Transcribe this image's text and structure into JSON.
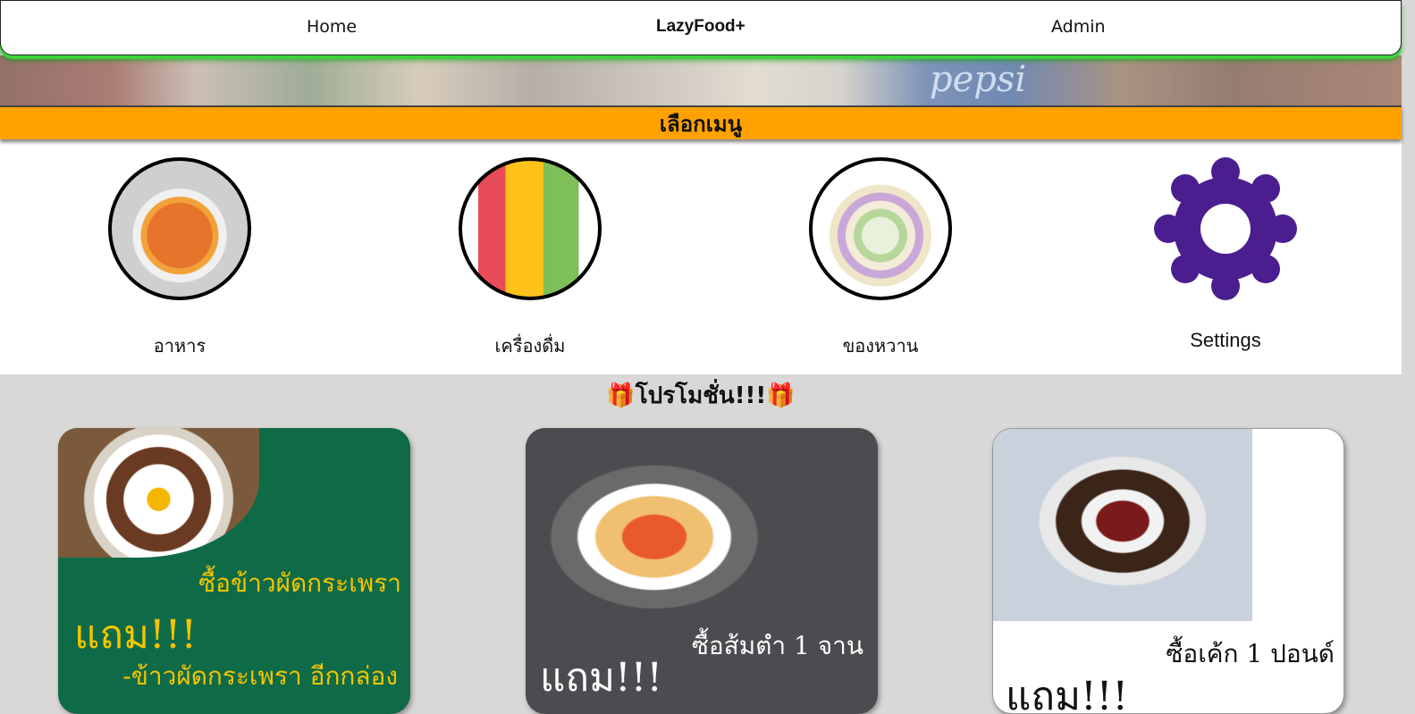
{
  "nav": {
    "home": "Home",
    "brand": "LazyFood+",
    "admin": "Admin"
  },
  "banner": {
    "pepsi_text": "pepsi"
  },
  "menu": {
    "title": "เลือกเมนู"
  },
  "categories": [
    {
      "label": "อาหาร",
      "icon": "food-image"
    },
    {
      "label": "เครื่องดื่ม",
      "icon": "drink-image"
    },
    {
      "label": "ของหวาน",
      "icon": "dessert-image"
    },
    {
      "label": "Settings",
      "icon": "gear-icon"
    }
  ],
  "promo": {
    "title": "โปรโมชั่น!!!",
    "gift_icon": "🎁",
    "cards": [
      {
        "line1": "ซื้อข้าวผัดกระเพรา",
        "line2": "แถม!!!",
        "line3": "-ข้าวผัดกระเพรา อีกกล่อง"
      },
      {
        "line1": "ซื้อส้มตำ 1 จาน",
        "line2": "แถม!!!"
      },
      {
        "line1": "ซื้อเค้ก 1 ปอนด์",
        "line2": "แถม!!!"
      }
    ]
  },
  "colors": {
    "accent_orange": "#ffa200",
    "settings_purple": "#4b1e8f",
    "nav_green": "#3ad33a"
  }
}
